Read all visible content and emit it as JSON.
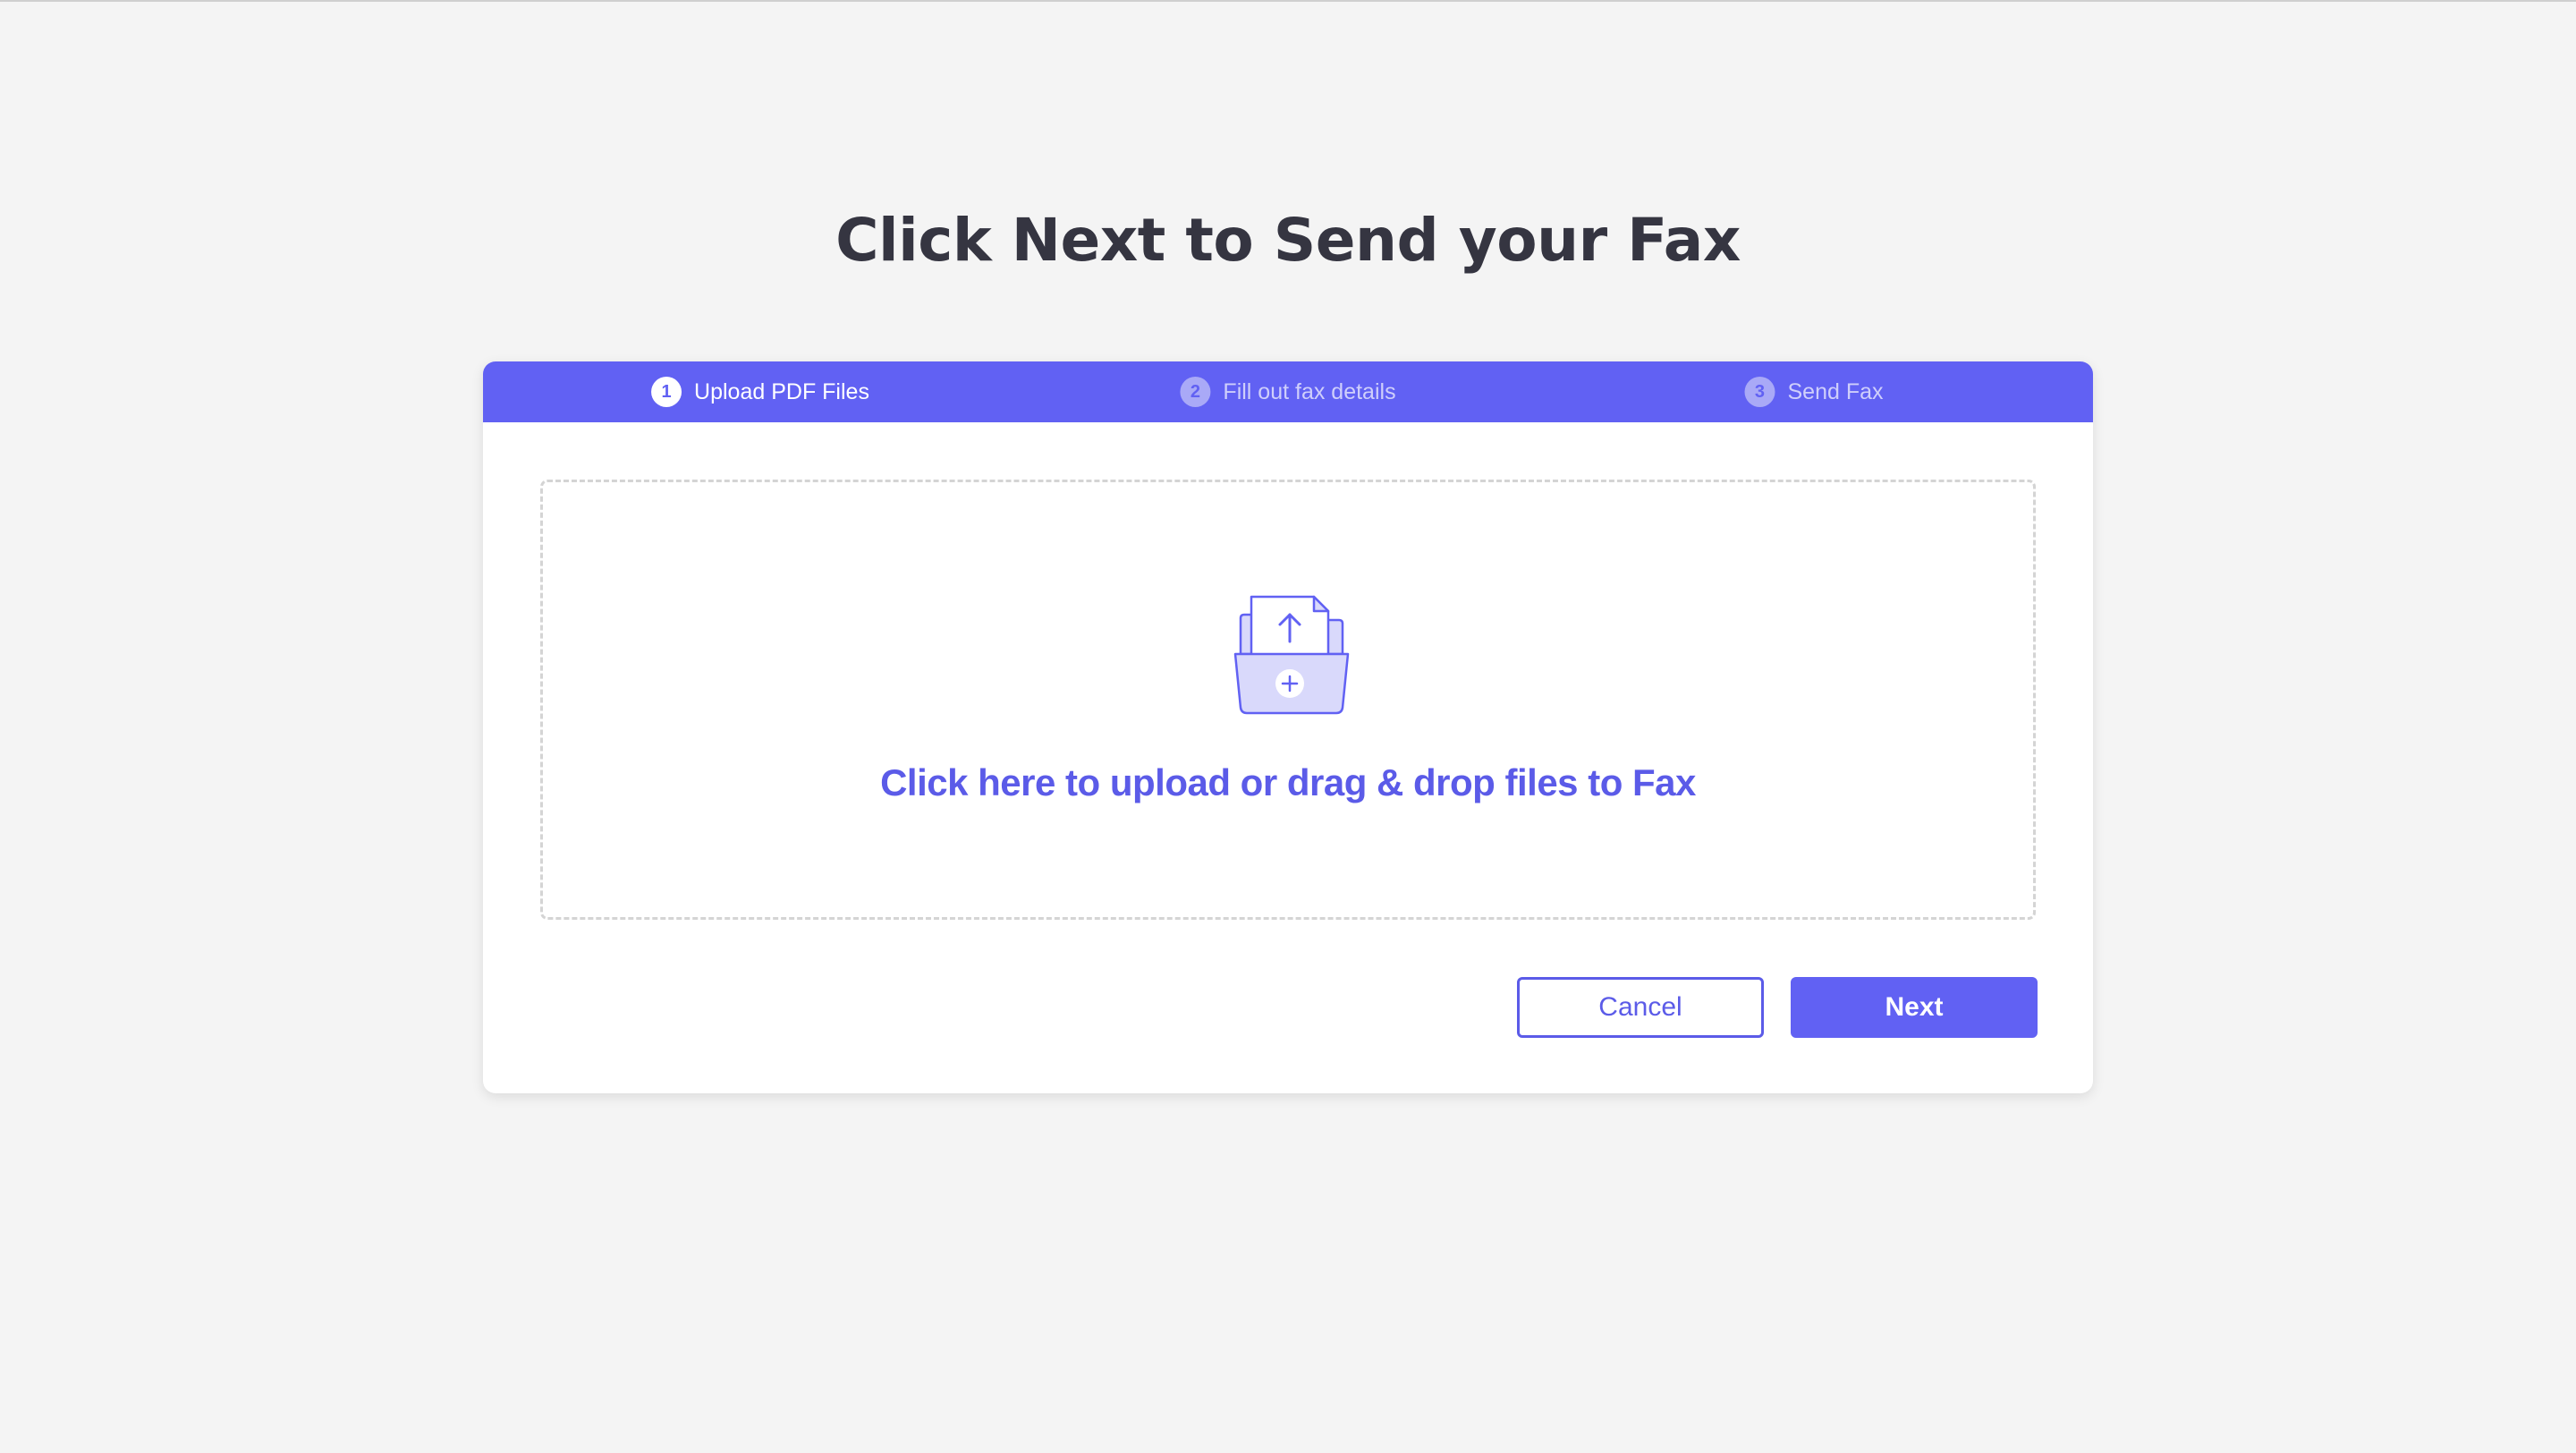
{
  "page": {
    "title": "Click Next to Send your Fax"
  },
  "stepper": {
    "steps": [
      {
        "number": "1",
        "label": "Upload PDF Files",
        "state": "active"
      },
      {
        "number": "2",
        "label": "Fill out fax details",
        "state": "inactive"
      },
      {
        "number": "3",
        "label": "Send Fax",
        "state": "inactive"
      }
    ]
  },
  "upload": {
    "icon": "folder-upload-icon",
    "text": "Click here to upload or drag & drop files to Fax"
  },
  "actions": {
    "cancel_label": "Cancel",
    "next_label": "Next"
  },
  "colors": {
    "accent": "#6161f3",
    "title": "#353541",
    "background": "#f4f4f4"
  }
}
